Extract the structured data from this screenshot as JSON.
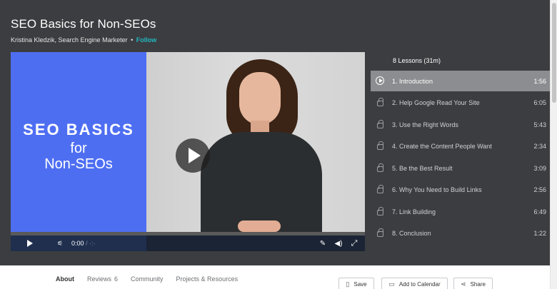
{
  "course": {
    "title": "SEO Basics for Non-SEOs",
    "author": "Kristina Kledzik, Search Engine Marketer",
    "separator": "•",
    "follow_label": "Follow"
  },
  "video": {
    "slate_line1": "SEO BASICS",
    "slate_line2": "for",
    "slate_line3": "Non-SEOs",
    "time_current": "0:00",
    "time_sep": "/",
    "time_total": "·:·"
  },
  "lessons": {
    "header": "8 Lessons (31m)",
    "items": [
      {
        "label": "1. Introduction",
        "duration": "1:56"
      },
      {
        "label": "2. Help Google Read Your Site",
        "duration": "6:05"
      },
      {
        "label": "3. Use the Right Words",
        "duration": "5:43"
      },
      {
        "label": "4. Create the Content People Want",
        "duration": "2:34"
      },
      {
        "label": "5. Be the Best Result",
        "duration": "3:09"
      },
      {
        "label": "6. Why You Need to Build Links",
        "duration": "2:56"
      },
      {
        "label": "7. Link Building",
        "duration": "6:49"
      },
      {
        "label": "8. Conclusion",
        "duration": "1:22"
      }
    ]
  },
  "tabs": {
    "about": "About",
    "reviews": "Reviews",
    "reviews_count": "6",
    "community": "Community",
    "projects": "Projects & Resources"
  },
  "actions": {
    "save": "Save",
    "calendar": "Add to Calendar",
    "share": "Share"
  },
  "colors": {
    "hero_bg": "#3b3d40",
    "accent": "#22b8c0",
    "slate_blue": "#4e6ef2",
    "active_lesson": "#8c8d90"
  }
}
